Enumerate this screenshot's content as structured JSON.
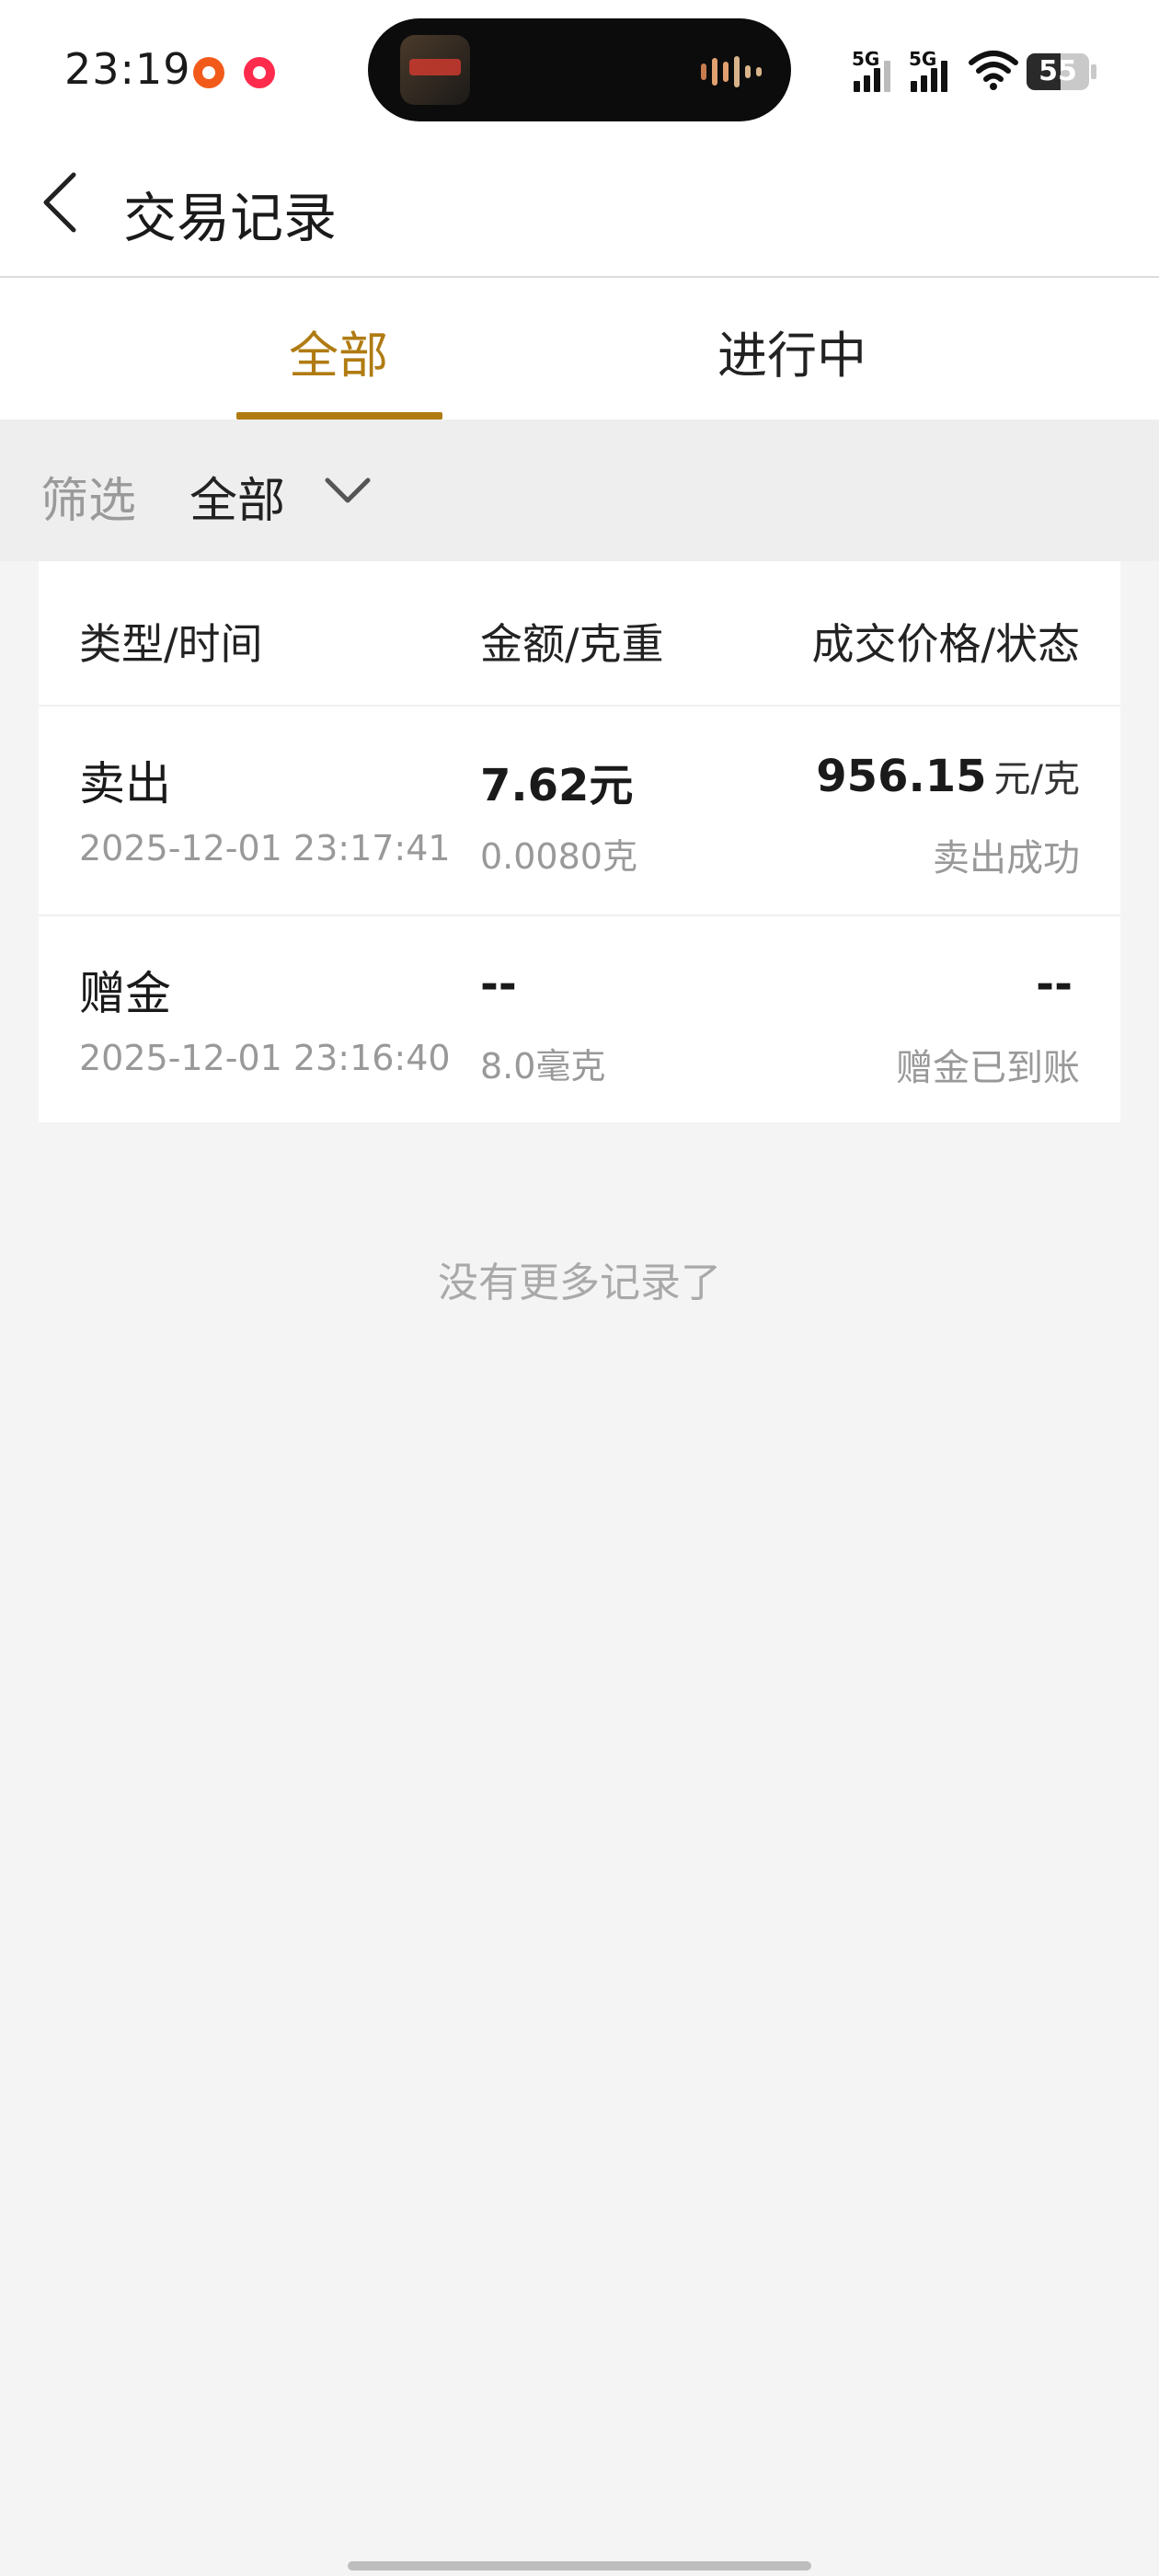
{
  "status_bar": {
    "time": "23:19",
    "network1": "5G",
    "network2": "5G",
    "battery_level": "55",
    "battery_fraction": 0.55
  },
  "header": {
    "title": "交易记录"
  },
  "tabs": [
    {
      "label": "全部",
      "active": true
    },
    {
      "label": "进行中",
      "active": false
    }
  ],
  "filter": {
    "label": "筛选",
    "value": "全部"
  },
  "table": {
    "headers": [
      "类型/时间",
      "金额/克重",
      "成交价格/状态"
    ],
    "rows": [
      {
        "type": "卖出",
        "time": "2025-12-01 23:17:41",
        "amount": "7.62元",
        "weight": "0.0080克",
        "price": "956.15",
        "price_unit": "元/克",
        "status": "卖出成功"
      },
      {
        "type": "赠金",
        "time": "2025-12-01 23:16:40",
        "amount": "--",
        "weight": "8.0毫克",
        "price": "--",
        "price_unit": "",
        "status": "赠金已到账"
      }
    ]
  },
  "footer": {
    "no_more": "没有更多记录了"
  },
  "colors": {
    "accent": "#b07b12",
    "background": "#f4f4f4",
    "muted_text": "#999999"
  }
}
